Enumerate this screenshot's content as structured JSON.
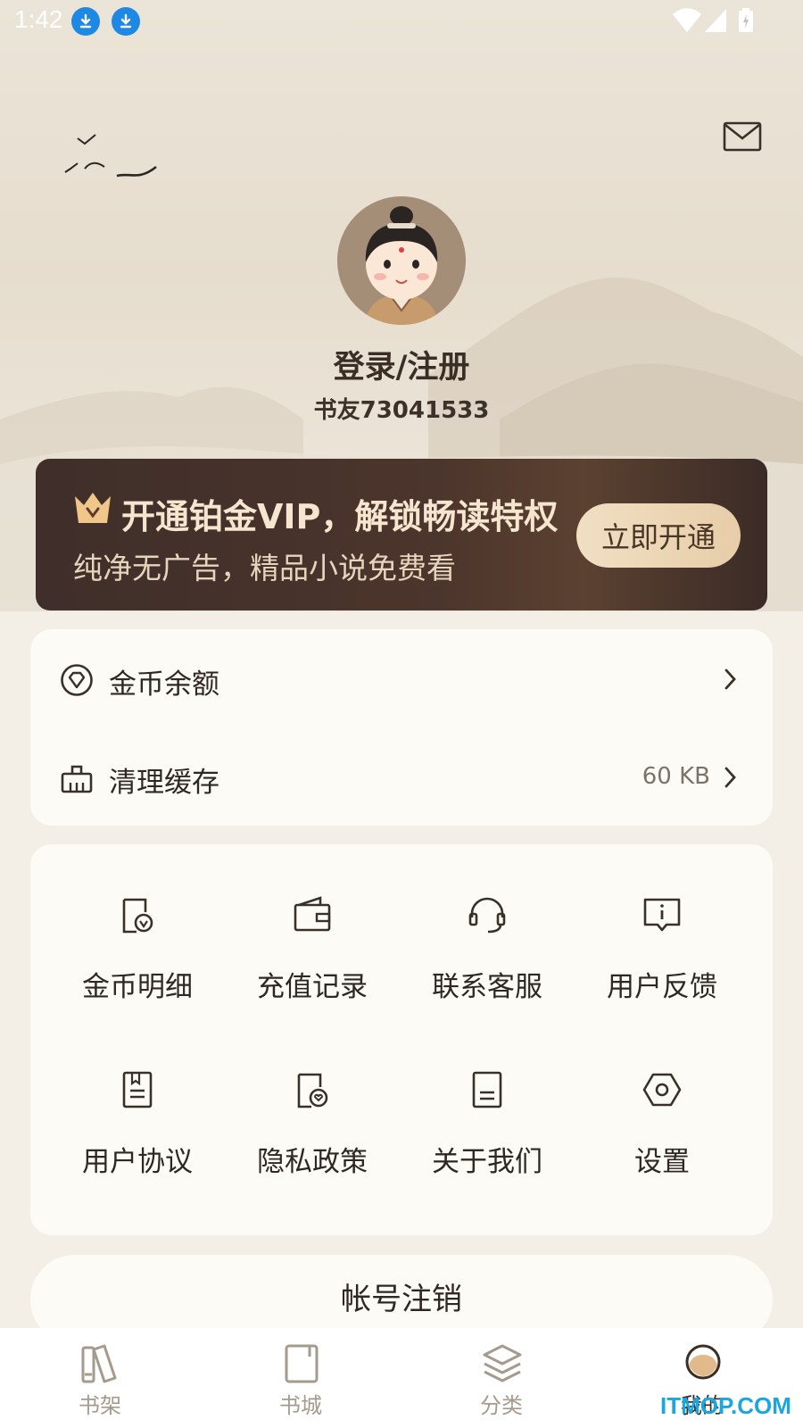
{
  "status_bar": {
    "time": "1:42"
  },
  "profile": {
    "login_label": "登录/注册",
    "user_id": "书友73041533"
  },
  "vip": {
    "title": "开通铂金VIP，解锁畅读特权",
    "subtitle": "纯净无广告，精品小说免费看",
    "button": "立即开通"
  },
  "account_rows": [
    {
      "label": "金币余额",
      "value": "",
      "icon": "coin-diamond-icon"
    },
    {
      "label": "清理缓存",
      "value": "60 KB",
      "icon": "broom-icon"
    }
  ],
  "grid": [
    {
      "label": "金币明细",
      "icon": "coin-detail-icon"
    },
    {
      "label": "充值记录",
      "icon": "wallet-icon"
    },
    {
      "label": "联系客服",
      "icon": "headset-icon"
    },
    {
      "label": "用户反馈",
      "icon": "feedback-icon"
    },
    {
      "label": "用户协议",
      "icon": "agreement-icon"
    },
    {
      "label": "隐私政策",
      "icon": "privacy-icon"
    },
    {
      "label": "关于我们",
      "icon": "about-icon"
    },
    {
      "label": "设置",
      "icon": "settings-icon"
    }
  ],
  "cancel_account": "帐号注销",
  "bottom_nav": [
    {
      "label": "书架",
      "icon": "bookshelf-icon",
      "active": false
    },
    {
      "label": "书城",
      "icon": "bookstore-icon",
      "active": false
    },
    {
      "label": "分类",
      "icon": "category-icon",
      "active": false
    },
    {
      "label": "我的",
      "icon": "profile-icon",
      "active": true
    }
  ],
  "watermark": "ITMOP.COM",
  "colors": {
    "accent_brown": "#5b4130",
    "text_dark": "#2f2822",
    "page_bg": "#f4efe6",
    "icon_stroke": "#3a302a",
    "nav_inactive": "#a69a8c"
  }
}
